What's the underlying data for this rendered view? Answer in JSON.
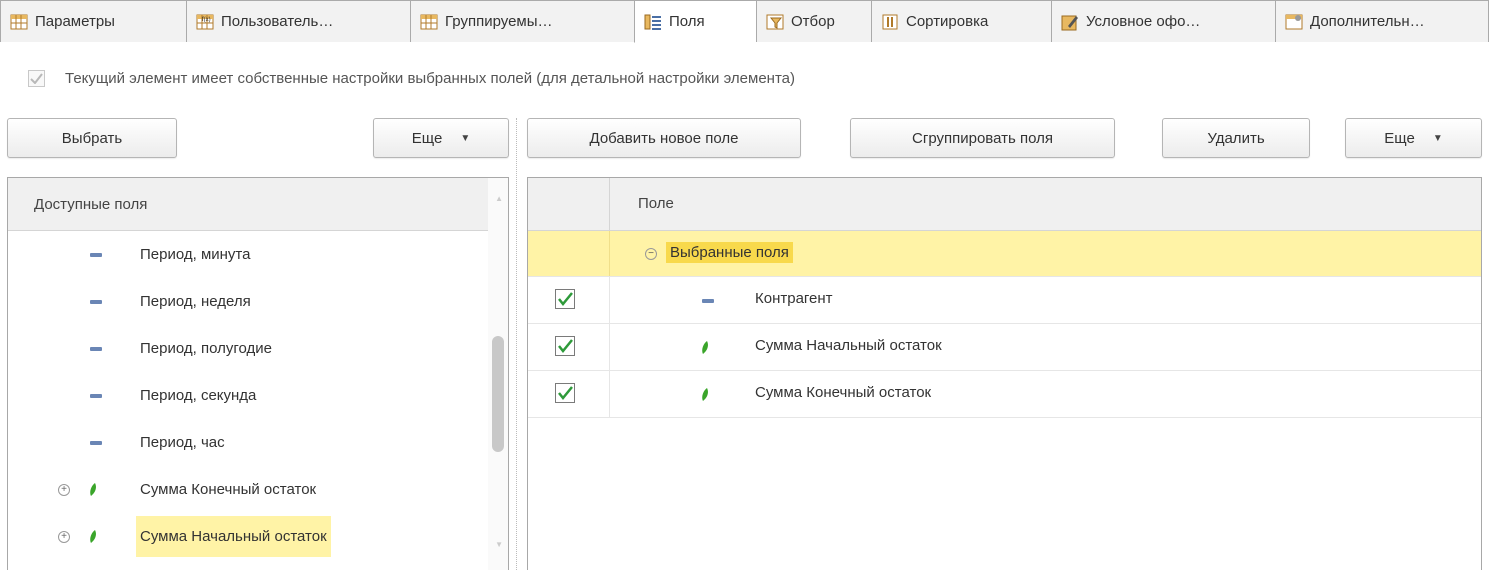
{
  "tabs": [
    {
      "label": "Параметры",
      "icon": "table-params-icon",
      "width": 186
    },
    {
      "label": "Пользователь…",
      "icon": "user-fields-icon",
      "width": 224
    },
    {
      "label": "Группируемы…",
      "icon": "grouping-table-icon",
      "width": 224
    },
    {
      "label": "Поля",
      "icon": "fields-list-icon",
      "width": 122,
      "active": true
    },
    {
      "label": "Отбор",
      "icon": "filter-icon",
      "width": 115
    },
    {
      "label": "Сортировка",
      "icon": "sort-icon",
      "width": 180
    },
    {
      "label": "Условное офо…",
      "icon": "conditional-format-icon",
      "width": 224
    },
    {
      "label": "Дополнительн…",
      "icon": "additional-settings-icon",
      "width": 214
    }
  ],
  "own_settings": {
    "label": "Текущий элемент имеет собственные настройки выбранных полей (для детальной настройки элемента)",
    "checked": true,
    "disabled": true
  },
  "left_toolbar": {
    "select_label": "Выбрать",
    "more_label": "Еще"
  },
  "right_toolbar": {
    "add_label": "Добавить новое поле",
    "group_label": "Сгруппировать поля",
    "delete_label": "Удалить",
    "more_label": "Еще"
  },
  "available_fields": {
    "header": "Доступные поля",
    "items": [
      {
        "label": "Период, минута",
        "icon": "dimension-icon",
        "expandable": false,
        "highlighted": false
      },
      {
        "label": "Период, неделя",
        "icon": "dimension-icon",
        "expandable": false,
        "highlighted": false
      },
      {
        "label": "Период, полугодие",
        "icon": "dimension-icon",
        "expandable": false,
        "highlighted": false
      },
      {
        "label": "Период, секунда",
        "icon": "dimension-icon",
        "expandable": false,
        "highlighted": false
      },
      {
        "label": "Период, час",
        "icon": "dimension-icon",
        "expandable": false,
        "highlighted": false
      },
      {
        "label": "Сумма Конечный остаток",
        "icon": "resource-icon",
        "expandable": true,
        "highlighted": false
      },
      {
        "label": "Сумма Начальный остаток",
        "icon": "resource-icon",
        "expandable": true,
        "highlighted": true
      }
    ]
  },
  "selected_fields": {
    "header": "Поле",
    "group_label": "Выбранные поля",
    "items": [
      {
        "label": "Контрагент",
        "icon": "dimension-icon",
        "checked": true
      },
      {
        "label": "Сумма Начальный остаток",
        "icon": "resource-icon",
        "checked": true
      },
      {
        "label": "Сумма Конечный остаток",
        "icon": "resource-icon",
        "checked": true
      }
    ]
  },
  "colors": {
    "highlight": "#fff3a6",
    "group_label_bg": "#f8d94c",
    "check_green": "#2e9a3a",
    "resource_green": "#3aa52a",
    "dimension_blue": "#6a86b5"
  }
}
